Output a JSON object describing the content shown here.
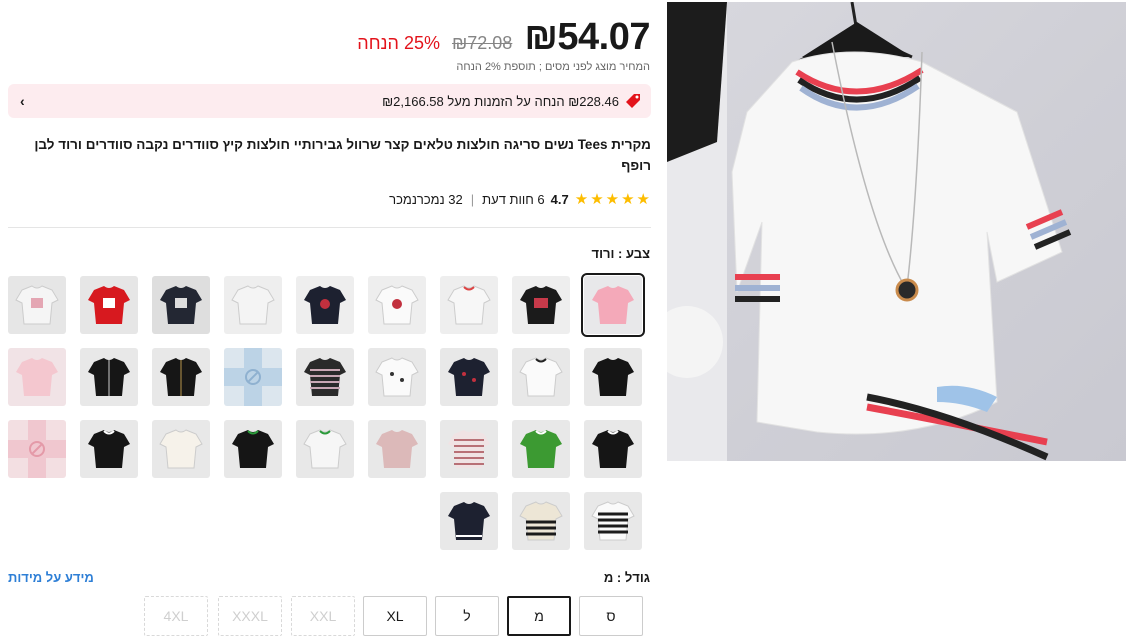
{
  "price": {
    "current": "₪54.07",
    "original": "₪72.08",
    "discount": "25% הנחה",
    "tax_note": "המחיר מוצג לפני מסים ; תוספת 2% הנחה"
  },
  "coupon": {
    "text": "₪228.46 הנחה על הזמנות מעל ₪2,166.58",
    "icon": "tag-icon",
    "chevron": "‹"
  },
  "product": {
    "title": "מקרית Tees נשים סריגה חולצות טלאים קצר שרוול גבירותיי חולצות קיץ סוודרים נקבה סוודרים ורוד לבן רופף"
  },
  "rating": {
    "value": "4.7",
    "reviews": "6 חוות דעת",
    "sold": "32 נמכרנמכר",
    "star_color": "#fdbd00"
  },
  "color": {
    "label": "צבע : ורוד"
  },
  "size": {
    "label": "גודל : מ",
    "guide_label": "מידע על מידות",
    "options": [
      "S",
      "M",
      "L",
      "XL",
      "XXL",
      "XXXL",
      "4XL"
    ],
    "display": [
      "ס",
      "מ",
      "ל",
      "XL",
      "XXL",
      "XXXL",
      "4XL"
    ],
    "selected": "M",
    "disabled": [
      "XXL",
      "XXXL",
      "4XL"
    ]
  },
  "colors": {
    "accent_red": "#e3131b",
    "coupon_bg": "#fdecef",
    "link_blue": "#2e7fd6"
  }
}
